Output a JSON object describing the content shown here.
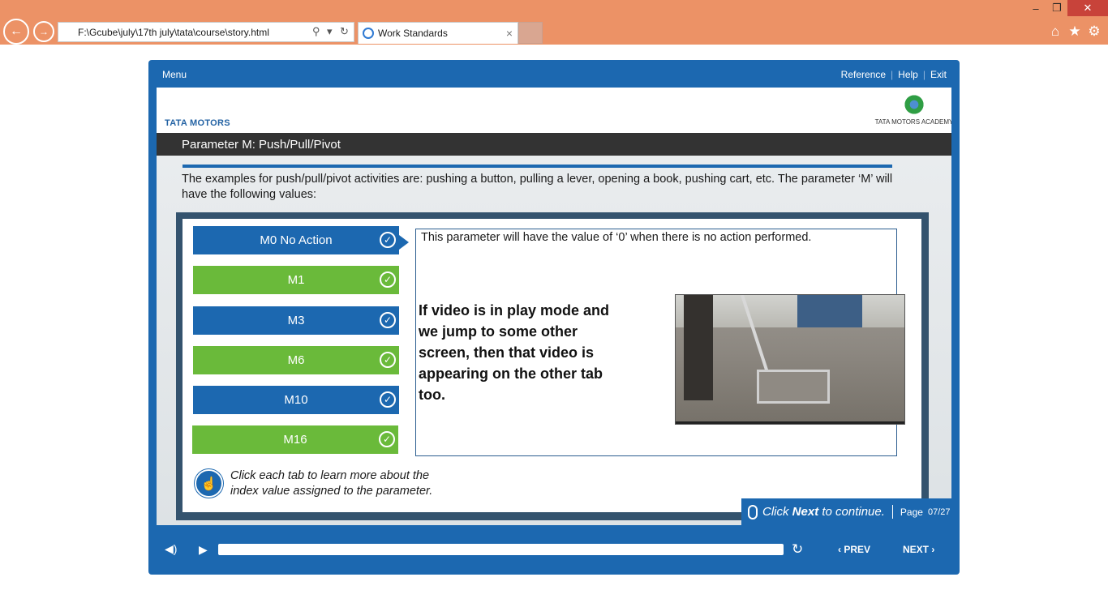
{
  "browser": {
    "address": "F:\\Gcube\\july\\17th july\\tata\\course\\story.html",
    "tab_title": "Work Standards",
    "tab_close": "×",
    "search_glyph": "⚲",
    "dropdown_glyph": "▾",
    "refresh_glyph": "↻",
    "back_glyph": "←",
    "forward_glyph": "→",
    "min_glyph": "–",
    "restore_glyph": "❐",
    "close_glyph": "✕",
    "home_glyph": "⌂",
    "star_glyph": "★",
    "gear_glyph": "⚙"
  },
  "topbar": {
    "menu_label": "Menu",
    "reference_label": "Reference",
    "help_label": "Help",
    "exit_label": "Exit",
    "separator": "|"
  },
  "header": {
    "company_logo_text": "TATA MOTORS",
    "academy_logo_text": "TATA MOTORS ACADEMY",
    "title": "Parameter M: Push/Pull/Pivot"
  },
  "intro": "The examples for push/pull/pivot activities are: pushing a button, pulling a lever, opening a book, pushing cart, etc. The parameter ‘M’ will have the following values:",
  "tabs": [
    {
      "label": "M0 No Action",
      "color": "blue"
    },
    {
      "label": "M1",
      "color": "green"
    },
    {
      "label": "M3",
      "color": "blue"
    },
    {
      "label": "M6",
      "color": "green"
    },
    {
      "label": "M10",
      "color": "blue"
    },
    {
      "label": "M16",
      "color": "green"
    }
  ],
  "check_glyph": "✓",
  "description": "This parameter will have the value of ‘0’ when there is no action performed.",
  "note": "If video is in play mode and we jump to some other screen, then that video is appearing on the other tab too.",
  "hint": "Click each tab to learn more about the index value assigned to the parameter.",
  "hint_glyph": "☝",
  "next_hint": {
    "prefix": "Click ",
    "bold": "Next",
    "suffix": " to continue.",
    "page_label": "Page",
    "page_number": "07/27"
  },
  "controls": {
    "volume_glyph": "◀)",
    "play_glyph": "▶",
    "replay_glyph": "↻",
    "prev_label": "‹  PREV",
    "next_label": "NEXT  ›"
  },
  "colors": {
    "brand_blue": "#1c68b0",
    "tab_green": "#6aba3a",
    "chrome_orange": "#ec9266",
    "title_bar": "#333333"
  }
}
